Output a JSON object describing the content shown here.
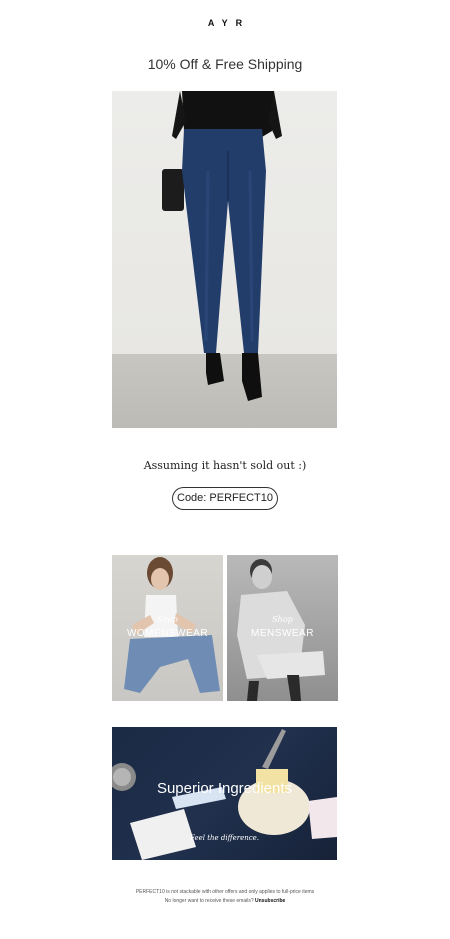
{
  "brand": {
    "logo": "AYR"
  },
  "header": {
    "headline": "10% Off & Free Shipping"
  },
  "hero": {
    "tagline": "Assuming it hasn't sold out :)",
    "code_label": "Code: PERFECT10"
  },
  "tiles": [
    {
      "shop": "Shop",
      "category": "WOMENSWEAR"
    },
    {
      "shop": "Shop",
      "category": "MENSWEAR"
    }
  ],
  "banner": {
    "title": "Superior Ingredients",
    "subtitle": "Feel the difference."
  },
  "footer": {
    "disclaimer": "PERFECT10 is not stackable with other offers and only applies to full-price items",
    "optout_text": "No longer want to receive these emails?",
    "unsubscribe": "Unsubscribe"
  }
}
